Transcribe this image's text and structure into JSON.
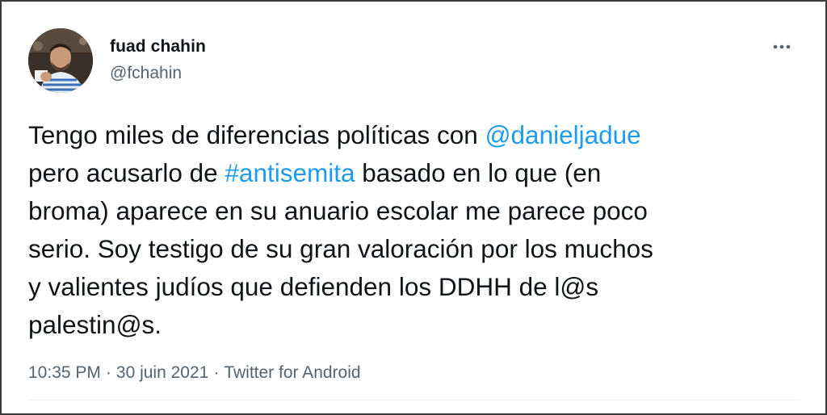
{
  "author": {
    "display_name": "fuad chahin",
    "handle": "@fchahin"
  },
  "tweet": {
    "lines": [
      [
        {
          "text": "Tengo miles de diferencias políticas con "
        },
        {
          "text": "@danieljadue",
          "link": true
        }
      ],
      [
        {
          "text": "pero acusarlo de "
        },
        {
          "text": "#antisemita",
          "link": true
        },
        {
          "text": " basado en lo que (en"
        }
      ],
      [
        {
          "text": "broma) aparece en su anuario escolar me parece poco"
        }
      ],
      [
        {
          "text": "serio. Soy testigo de su gran valoración por los muchos"
        }
      ],
      [
        {
          "text": "y valientes judíos que defienden los DDHH de l@s"
        }
      ],
      [
        {
          "text": "palestin@s."
        }
      ]
    ]
  },
  "meta": {
    "time": "10:35 PM",
    "separator": "·",
    "date": "30 juin 2021",
    "source": "Twitter for Android"
  },
  "colors": {
    "link": "#1d9bf0",
    "secondary_text": "#536471",
    "primary_text": "#0f1419"
  },
  "icons": {
    "more": "more-horizontal-icon",
    "avatar": "profile-photo"
  }
}
